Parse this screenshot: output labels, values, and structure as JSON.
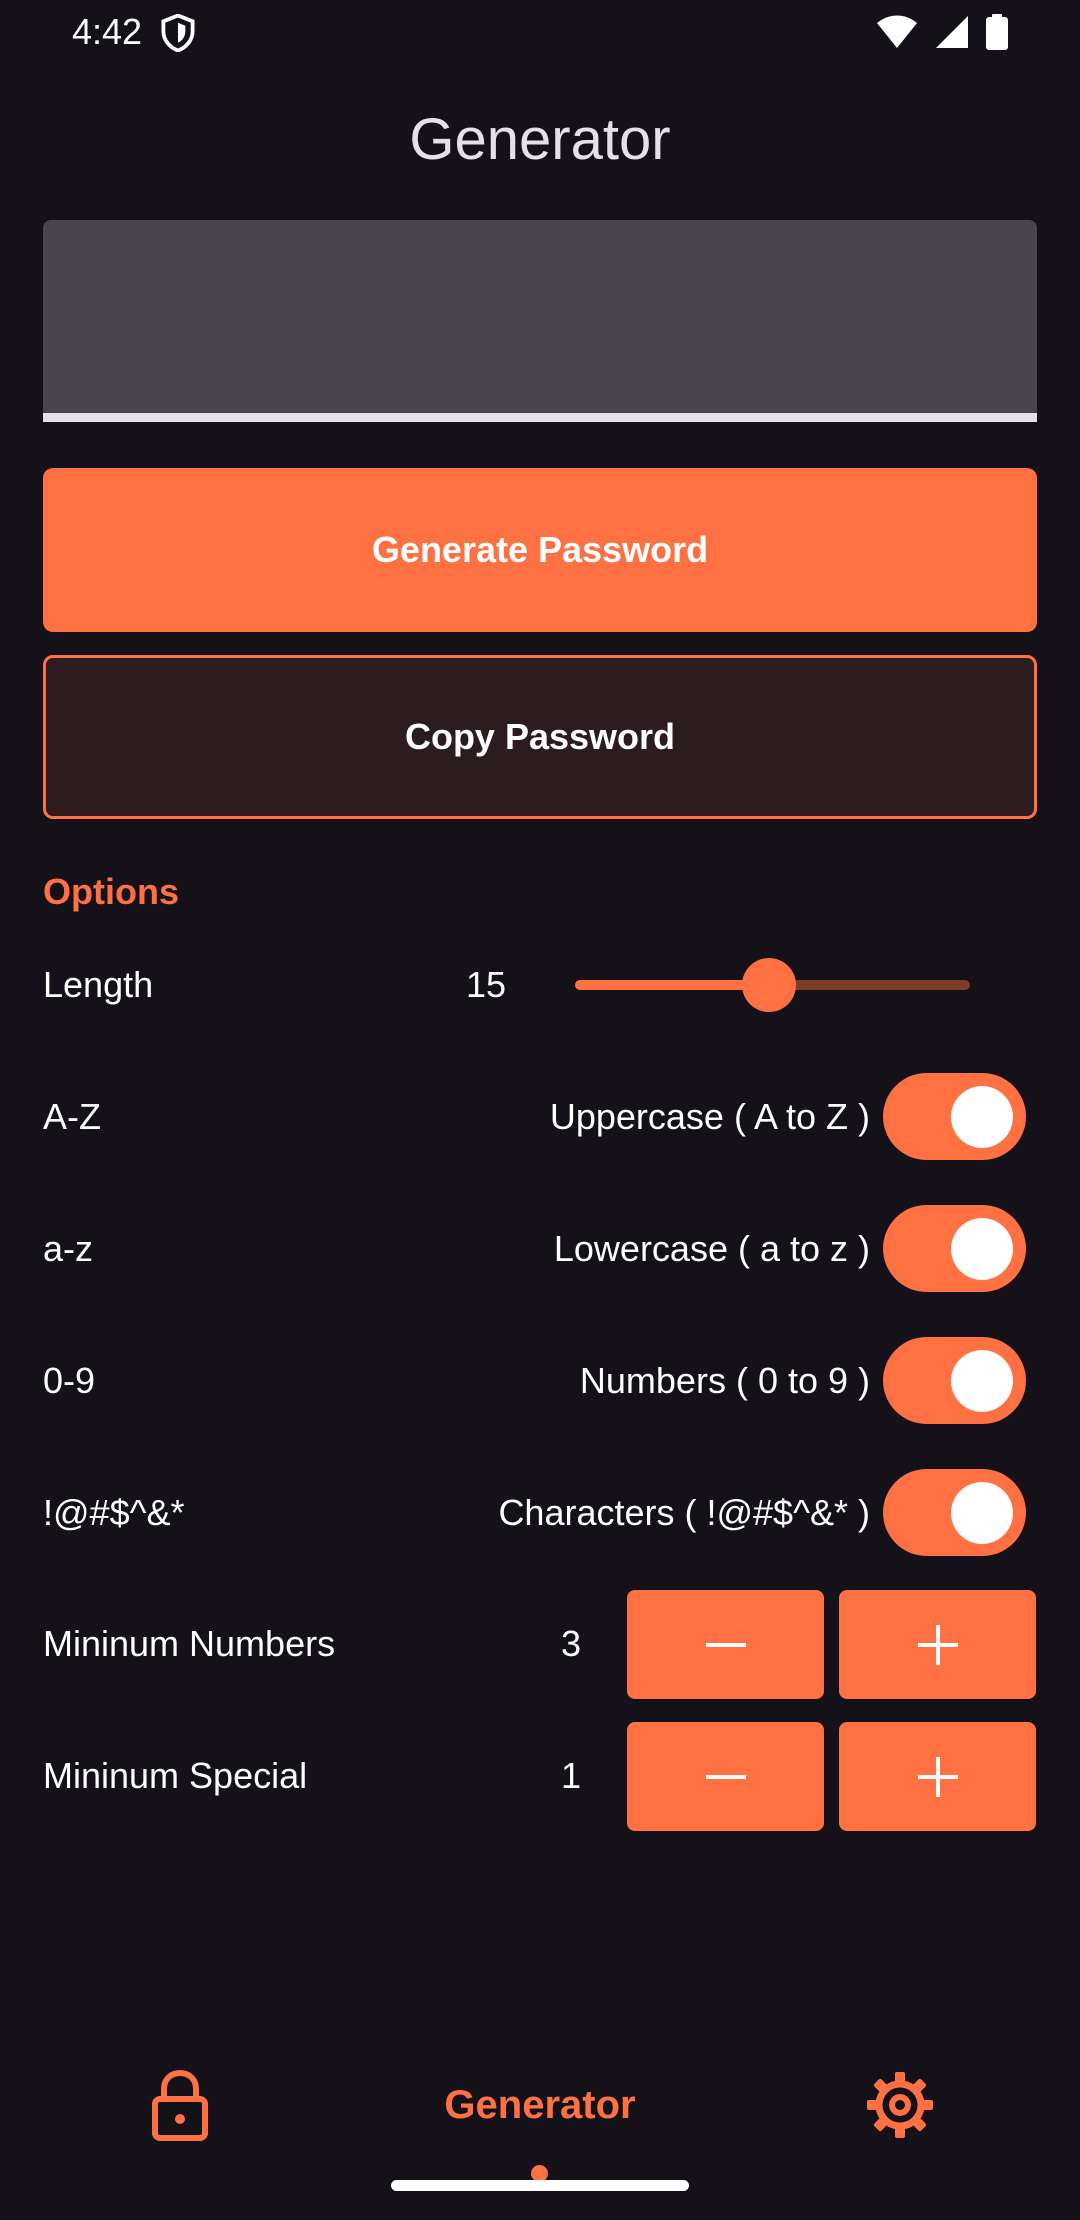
{
  "status_bar": {
    "time": "4:42"
  },
  "header": {
    "title": "Generator"
  },
  "password_field": {
    "value": ""
  },
  "actions": {
    "generate_label": "Generate Password",
    "copy_label": "Copy Password"
  },
  "options": {
    "section_title": "Options",
    "length": {
      "label": "Length",
      "value": "15",
      "slider_fraction": 0.49
    },
    "toggles": [
      {
        "label": "A-Z",
        "description": "Uppercase ( A to Z )",
        "on": true
      },
      {
        "label": "a-z",
        "description": "Lowercase ( a to z )",
        "on": true
      },
      {
        "label": "0-9",
        "description": "Numbers ( 0 to 9 )",
        "on": true
      },
      {
        "label": "!@#$^&*",
        "description": "Characters ( !@#$^&* )",
        "on": true
      }
    ],
    "min_numbers": {
      "label": "Mininum Numbers",
      "value": "3"
    },
    "min_special": {
      "label": "Mininum Special",
      "value": "1"
    }
  },
  "bottom_nav": {
    "items": [
      {
        "icon": "lock-icon"
      },
      {
        "label": "Generator",
        "active": true
      },
      {
        "icon": "gear-icon"
      }
    ]
  },
  "colors": {
    "accent": "#ff7043",
    "background": "#141218",
    "field": "#49454f"
  }
}
